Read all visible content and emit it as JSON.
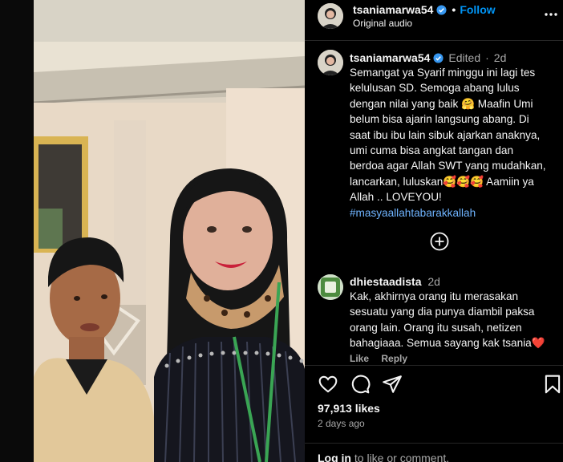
{
  "post": {
    "username": "tsaniamarwa54",
    "follow_label": "Follow",
    "separator": "•",
    "audio": "Original audio"
  },
  "caption": {
    "username": "tsaniamarwa54",
    "edited_label": "Edited",
    "separator": "·",
    "time": "2d",
    "lines": [
      "Semangat ya Syarif minggu ini lagi tes",
      "kelulusan SD. Semoga abang lulus",
      "dengan nilai yang baik 🤗 Maafin Umi",
      "belum bisa ajarin langsung abang. Di",
      "saat ibu ibu lain sibuk ajarkan anaknya,",
      "umi cuma bisa angkat tangan dan",
      "berdoa agar Allah SWT yang mudahkan,",
      "lancarkan, luluskan🥰🥰🥰 Aamiin ya",
      "Allah .. LOVEYOU!"
    ],
    "hashtag": "#masyaallahtabarakkallah"
  },
  "comment": {
    "username": "dhiestaadista",
    "time": "2d",
    "lines": [
      "Kak, akhirnya orang itu merasakan",
      "sesuatu yang dia punya diambil paksa",
      "orang lain. Orang itu susah, netizen",
      "bahagiaaa. Semua sayang kak tsania❤️"
    ],
    "like_label": "Like",
    "reply_label": "Reply"
  },
  "stats": {
    "likes": "97,913 likes",
    "date": "2 days ago"
  },
  "login": {
    "link": "Log in",
    "rest": " to like or comment."
  },
  "icons": {
    "more": "more-icon",
    "plus": "plus-circle-icon",
    "like": "heart-icon",
    "comment": "comment-icon",
    "share": "share-icon",
    "save": "bookmark-icon",
    "mute": "speaker-icon",
    "verified": "verified-badge-icon"
  },
  "colors": {
    "accent": "#0095f6",
    "verified": "#3797f0",
    "secondary_text": "#a8a8a8"
  }
}
